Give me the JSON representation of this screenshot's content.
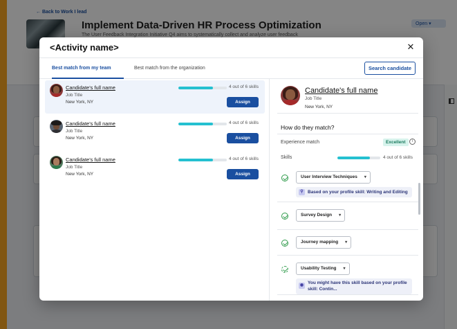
{
  "background": {
    "back_link": "← Back to Work I lead",
    "title": "Implement Data-Driven HR Process Optimization",
    "description": "The User Feedback Integration Initiative Q4 aims to systematically collect and analyze user feedback",
    "status": "Open"
  },
  "modal": {
    "title": "<Activity name>",
    "close_label": "✕",
    "tabs": [
      {
        "label": "Best match from my team",
        "active": true
      },
      {
        "label": "Best match from the organization",
        "active": false
      }
    ],
    "search_button": "Search candidate"
  },
  "candidates": [
    {
      "name": "Candidate's full name",
      "job": "Job Title",
      "location": "New York, NY",
      "skills_text": "4 out of 6 skills",
      "match_fraction": 0.72,
      "assign_label": "Assign",
      "selected": true
    },
    {
      "name": "Candidate's full name",
      "job": "Job Title",
      "location": "New York, NY",
      "skills_text": "4 out of 6 skills",
      "match_fraction": 0.72,
      "assign_label": "Assign",
      "selected": false
    },
    {
      "name": "Candidate's full name",
      "job": "Job Title",
      "location": "New York, NY",
      "skills_text": "4 out of 6 skills",
      "match_fraction": 0.72,
      "assign_label": "Assign",
      "selected": false
    }
  ],
  "detail": {
    "name": "Candidate's full name",
    "job": "Job Title",
    "location": "New York, NY",
    "match_heading": "How do they match?",
    "experience_label": "Experience match",
    "experience_value": "Excellent",
    "skills_label": "Skills",
    "skills_text": "4 out of 6 skills",
    "skills_fraction": 0.75,
    "skills": [
      {
        "name": "User Interview Techniques",
        "status": "matched",
        "note": "Based on your profile skill: Writing and Editing"
      },
      {
        "name": "Survey Design",
        "status": "matched",
        "note": ""
      },
      {
        "name": "Journey mapping",
        "status": "matched",
        "note": ""
      },
      {
        "name": "Usability Testing",
        "status": "possible",
        "note": "You might have this skill based on your profile skill: Contin..."
      }
    ]
  },
  "colors": {
    "brand": "#1a4fa0",
    "progress": "#24c0d0",
    "success": "#2e9a4a",
    "page_border": "#f7a521"
  }
}
